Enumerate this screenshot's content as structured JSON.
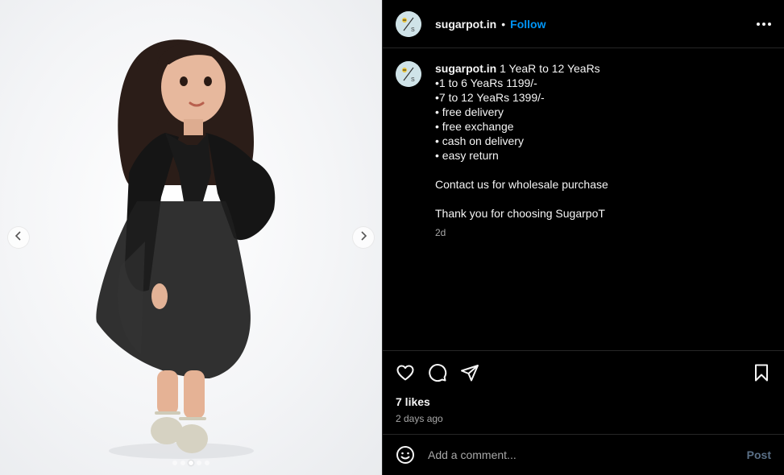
{
  "post": {
    "username": "sugarpot.in",
    "separator": "•",
    "follow_label": "Follow",
    "caption_lines": [
      "1 YeaR to 12 YeaRs",
      "•1 to 6 YeaRs 1199/-",
      "•7 to 12 YeaRs 1399/-",
      "• free delivery",
      "• free exchange",
      "• cash on delivery",
      "• easy return",
      "",
      "Contact us for wholesale purchase",
      "",
      "Thank you for choosing SugarpoT"
    ],
    "caption_time": "2d",
    "likes": "7 likes",
    "posted_ago": "2 days ago"
  },
  "comment": {
    "placeholder": "Add a comment...",
    "post_label": "Post"
  },
  "carousel": {
    "slide_count": 5,
    "active_index": 2
  },
  "colors": {
    "accent": "#0095f6",
    "background": "#000000",
    "secondary_text": "#a8a8a8",
    "divider": "#262626"
  },
  "icons": {
    "prev": "chevron-left-icon",
    "next": "chevron-right-icon",
    "more": "more-options-icon",
    "like": "heart-icon",
    "comment": "comment-icon",
    "share": "paper-plane-icon",
    "save": "bookmark-icon",
    "emoji": "emoji-icon"
  }
}
